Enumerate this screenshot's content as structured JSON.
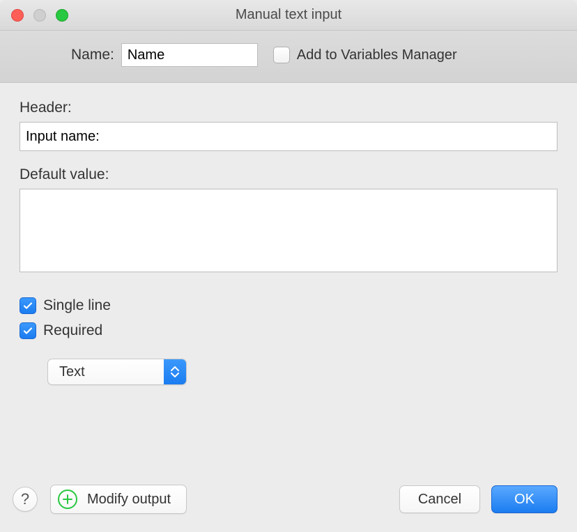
{
  "window": {
    "title": "Manual text input"
  },
  "header": {
    "name_label": "Name:",
    "name_value": "Name",
    "add_to_vars_label": "Add to Variables Manager",
    "add_to_vars_checked": false
  },
  "body": {
    "header_label": "Header:",
    "header_value": "Input name:",
    "default_value_label": "Default value:",
    "default_value": "",
    "single_line_label": "Single line",
    "single_line_checked": true,
    "required_label": "Required",
    "required_checked": true,
    "type_select": {
      "selected": "Text",
      "options": [
        "Text"
      ]
    }
  },
  "footer": {
    "help_label": "?",
    "modify_output_label": "Modify output",
    "cancel_label": "Cancel",
    "ok_label": "OK"
  }
}
